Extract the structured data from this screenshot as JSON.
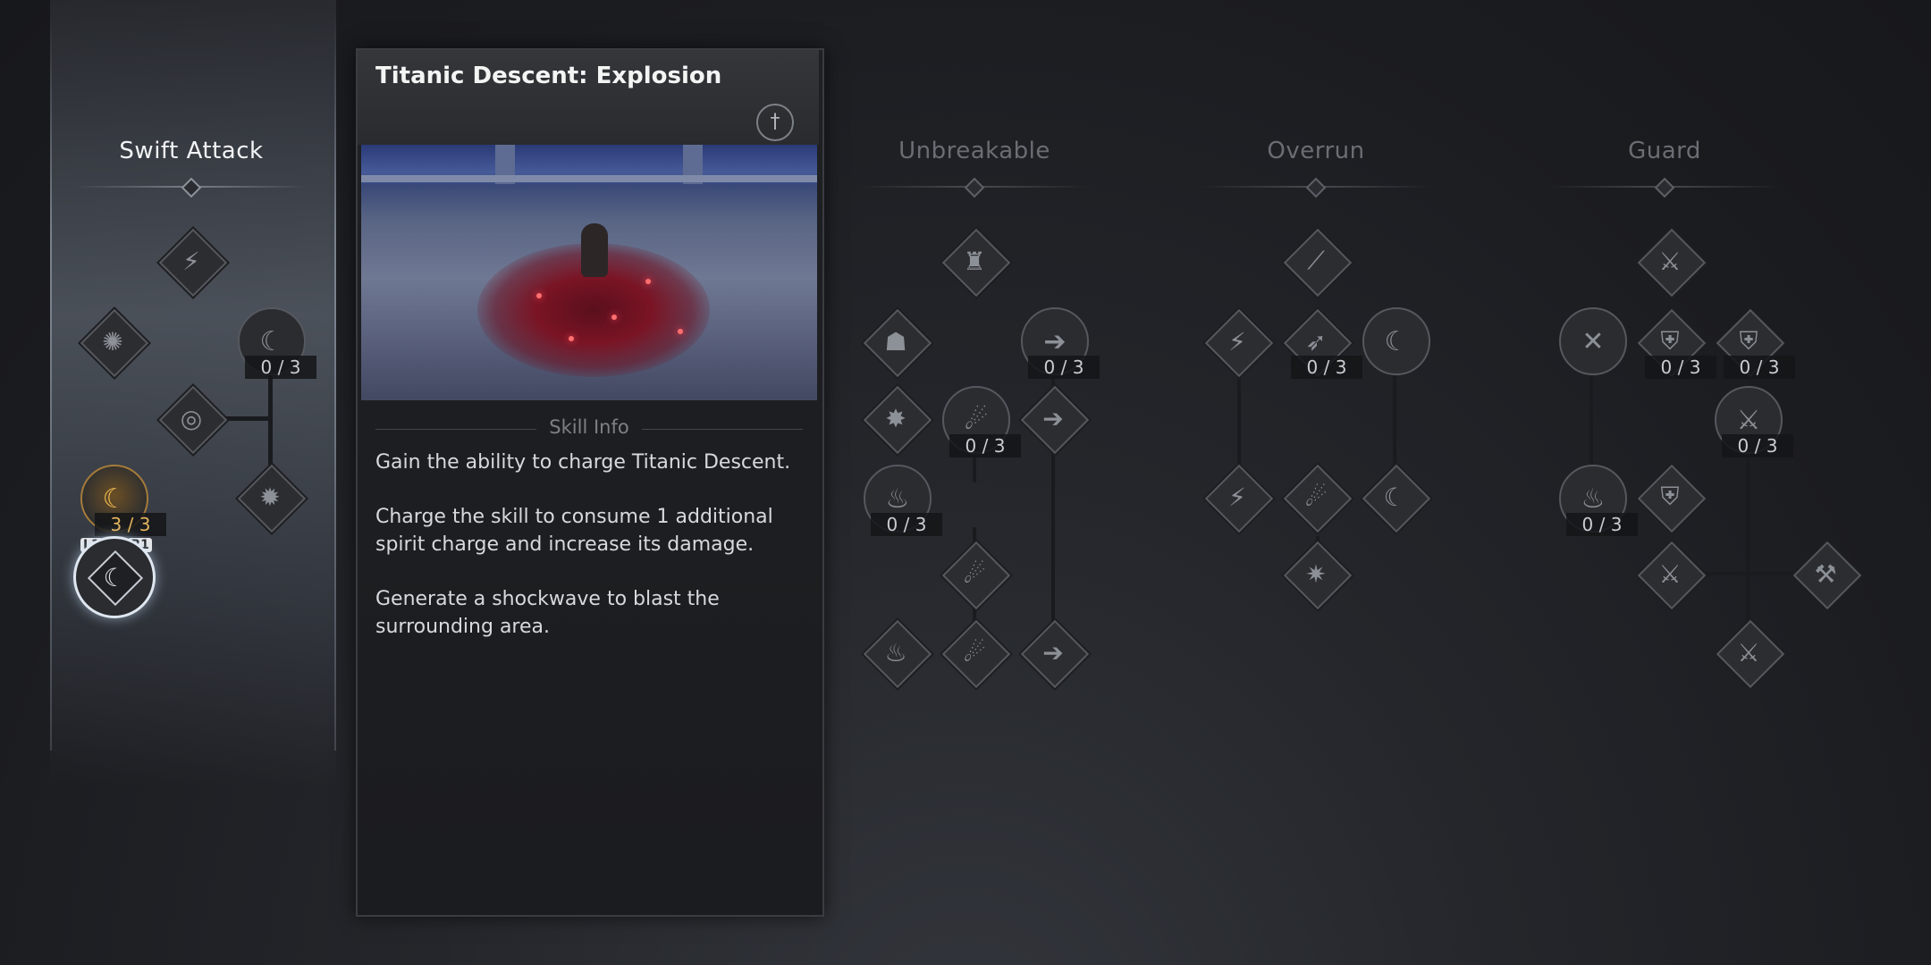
{
  "columns": [
    {
      "title": "Swift Attack",
      "active": true
    },
    {
      "title": "Unbreakable",
      "active": false
    },
    {
      "title": "Overrun",
      "active": false
    },
    {
      "title": "Guard",
      "active": false
    }
  ],
  "detail": {
    "title": "Titanic Descent: Explosion",
    "section_label": "Skill Info",
    "paragraphs": [
      "Gain the ability to charge Titanic Descent.",
      "Charge the skill to consume 1 additional spirit charge and increase its damage.",
      "Generate a shockwave to blast the surrounding area."
    ]
  },
  "swift_attack": {
    "counts": {
      "upper_circle": "0 / 3",
      "golden_circle": "3 / 3"
    },
    "binding": {
      "left": "L1",
      "plus": "+",
      "right": "R1"
    }
  },
  "unbreakable": {
    "counts": {
      "right_circle": "0 / 3",
      "middle_circle": "0 / 3",
      "left_circle": "0 / 3"
    }
  },
  "overrun": {
    "counts": {
      "middle_node": "0 / 3"
    }
  },
  "guard": {
    "counts": {
      "shield_a": "0 / 3",
      "shield_b": "0 / 3",
      "sword_node": "0 / 3",
      "left_circle": "0 / 3"
    }
  },
  "colors": {
    "accent_gold": "#e3b35d",
    "text_primary": "#f2f3f5",
    "text_dim": "#6a6d73"
  }
}
